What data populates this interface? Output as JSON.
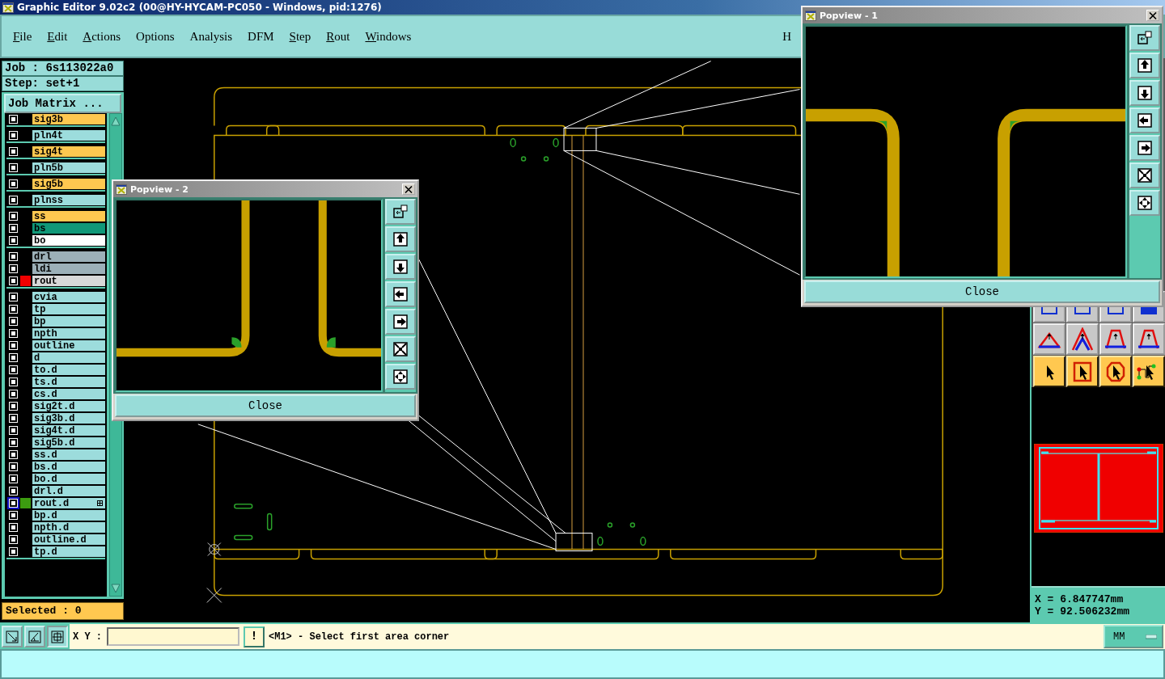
{
  "window": {
    "title": "Graphic Editor 9.02c2 (00@HY-HYCAM-PC050 - Windows, pid:1276)"
  },
  "menu": [
    {
      "label": "File",
      "mnemonic": true
    },
    {
      "label": "Edit",
      "mnemonic": true
    },
    {
      "label": "Actions",
      "mnemonic": true
    },
    {
      "label": "Options",
      "mnemonic": false
    },
    {
      "label": "Analysis",
      "mnemonic": false
    },
    {
      "label": "DFM",
      "mnemonic": false
    },
    {
      "label": "Step",
      "mnemonic": true
    },
    {
      "label": "Rout",
      "mnemonic": true
    },
    {
      "label": "Windows",
      "mnemonic": true
    },
    {
      "label": "H",
      "mnemonic": false
    }
  ],
  "job": {
    "job": "Job : 6s113022a0",
    "step": "Step: set+1",
    "matrix_button": "Job Matrix ..."
  },
  "layer_groups": [
    {
      "layers": [
        {
          "name": "sig3b",
          "kind": "signal",
          "active": false
        }
      ]
    },
    {
      "layers": [
        {
          "name": "pln4t",
          "kind": "plane",
          "active": false
        }
      ]
    },
    {
      "layers": [
        {
          "name": "sig4t",
          "kind": "signal",
          "active": false
        }
      ]
    },
    {
      "layers": [
        {
          "name": "pln5b",
          "kind": "plane",
          "active": false
        }
      ]
    },
    {
      "layers": [
        {
          "name": "sig5b",
          "kind": "signal",
          "active": false
        }
      ]
    },
    {
      "layers": [
        {
          "name": "plnss",
          "kind": "plane",
          "active": false
        }
      ]
    },
    {
      "layers": [
        {
          "name": "ss",
          "kind": "silk",
          "active": false
        },
        {
          "name": "bs",
          "kind": "mask",
          "active": false
        },
        {
          "name": "bo",
          "kind": "board",
          "active": false
        }
      ]
    },
    {
      "layers": [
        {
          "name": "drl",
          "kind": "drill",
          "active": false
        },
        {
          "name": "ldi",
          "kind": "drill",
          "active": false
        },
        {
          "name": "rout",
          "kind": "rout",
          "color": "#f00000",
          "active": false
        }
      ]
    },
    {
      "layers": [
        {
          "name": "cvia",
          "kind": "document",
          "active": false
        },
        {
          "name": "tp",
          "kind": "document",
          "active": false
        },
        {
          "name": "bp",
          "kind": "document",
          "active": false
        },
        {
          "name": "npth",
          "kind": "document",
          "active": false
        },
        {
          "name": "outline",
          "kind": "document",
          "active": false
        },
        {
          "name": "d",
          "kind": "document",
          "active": false
        },
        {
          "name": "to.d",
          "kind": "document",
          "active": false
        },
        {
          "name": "ts.d",
          "kind": "document",
          "active": false
        },
        {
          "name": "cs.d",
          "kind": "document",
          "active": false
        },
        {
          "name": "sig2t.d",
          "kind": "document",
          "active": false
        },
        {
          "name": "sig3b.d",
          "kind": "document",
          "active": false
        },
        {
          "name": "sig4t.d",
          "kind": "document",
          "active": false
        },
        {
          "name": "sig5b.d",
          "kind": "document",
          "active": false
        },
        {
          "name": "ss.d",
          "kind": "document",
          "active": false
        },
        {
          "name": "bs.d",
          "kind": "document",
          "active": false
        },
        {
          "name": "bo.d",
          "kind": "document",
          "active": false
        },
        {
          "name": "drl.d",
          "kind": "document",
          "active": false
        },
        {
          "name": "rout.d",
          "kind": "document",
          "color": "#3c9c10",
          "active": true
        },
        {
          "name": "bp.d",
          "kind": "document",
          "active": false
        },
        {
          "name": "npth.d",
          "kind": "document",
          "active": false
        },
        {
          "name": "outline.d",
          "kind": "document",
          "active": false
        },
        {
          "name": "tp.d",
          "kind": "document",
          "active": false
        }
      ]
    }
  ],
  "selected_count": "Selected : 0",
  "popviews": [
    {
      "title": "Popview - 1",
      "close_button": "Close"
    },
    {
      "title": "Popview - 2",
      "close_button": "Close"
    }
  ],
  "coordinates": {
    "x": "X = 6.847747mm",
    "y": "Y = 92.506232mm"
  },
  "command_bar": {
    "xy_label": "X Y :",
    "alert_button": "!",
    "message": "<M1> - Select first area corner",
    "units": "MM"
  }
}
